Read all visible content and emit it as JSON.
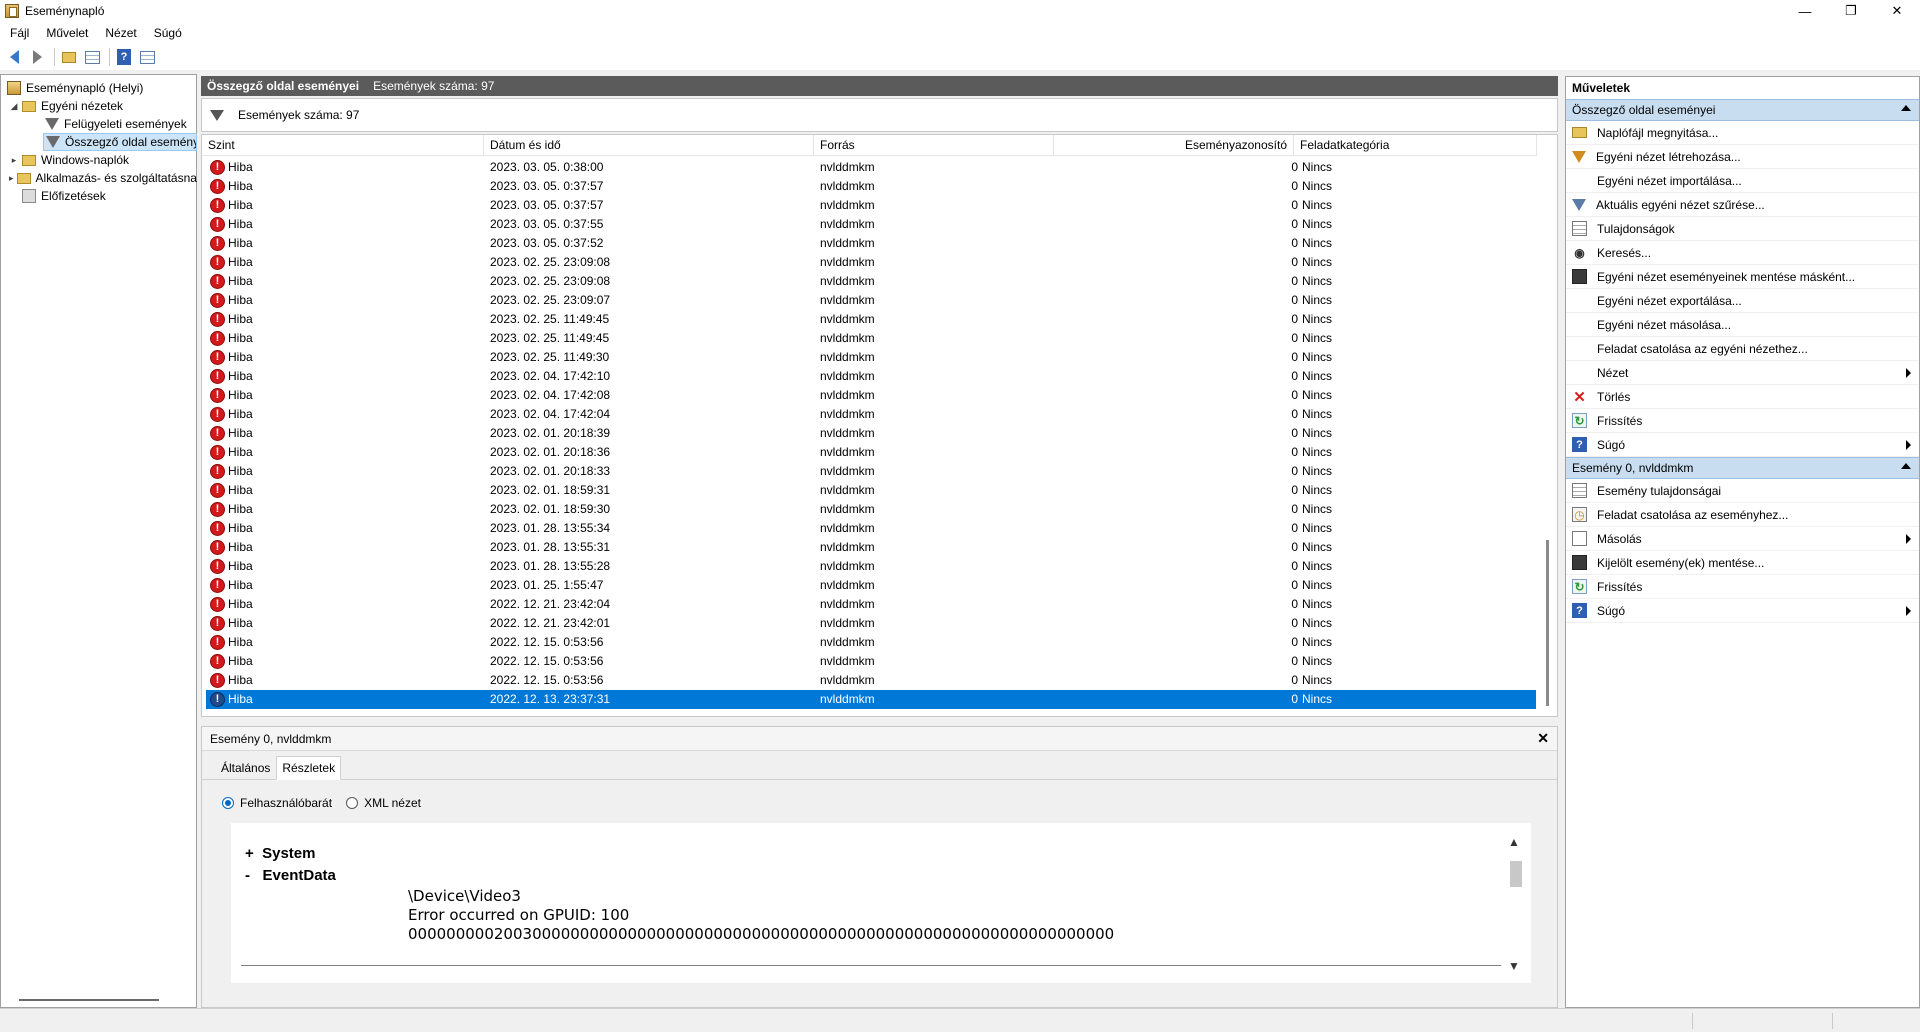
{
  "window": {
    "title": "Eseménynapló"
  },
  "menu": [
    "Fájl",
    "Művelet",
    "Nézet",
    "Súgó"
  ],
  "tree": {
    "root": "Eseménynapló (Helyi)",
    "custom_views": "Egyéni nézetek",
    "admin_events": "Felügyeleti események",
    "summary_events": "Összegző oldal eseményei",
    "windows_logs": "Windows-naplók",
    "app_service_logs": "Alkalmazás- és szolgáltatásnaplók",
    "subscriptions": "Előfizetések"
  },
  "center": {
    "title": "Összegző oldal eseményei",
    "count": "Események száma: 97",
    "filter_text": "Események száma: 97"
  },
  "table": {
    "headers": {
      "level": "Szint",
      "date": "Dátum és idő",
      "source": "Forrás",
      "event_id": "Eseményazonosító",
      "task": "Feladatkategória"
    },
    "rows": [
      {
        "level": "Hiba",
        "date": "2023. 03. 05. 0:38:00",
        "source": "nvlddmkm",
        "id": "0",
        "task": "Nincs"
      },
      {
        "level": "Hiba",
        "date": "2023. 03. 05. 0:37:57",
        "source": "nvlddmkm",
        "id": "0",
        "task": "Nincs"
      },
      {
        "level": "Hiba",
        "date": "2023. 03. 05. 0:37:57",
        "source": "nvlddmkm",
        "id": "0",
        "task": "Nincs"
      },
      {
        "level": "Hiba",
        "date": "2023. 03. 05. 0:37:55",
        "source": "nvlddmkm",
        "id": "0",
        "task": "Nincs"
      },
      {
        "level": "Hiba",
        "date": "2023. 03. 05. 0:37:52",
        "source": "nvlddmkm",
        "id": "0",
        "task": "Nincs"
      },
      {
        "level": "Hiba",
        "date": "2023. 02. 25. 23:09:08",
        "source": "nvlddmkm",
        "id": "0",
        "task": "Nincs"
      },
      {
        "level": "Hiba",
        "date": "2023. 02. 25. 23:09:08",
        "source": "nvlddmkm",
        "id": "0",
        "task": "Nincs"
      },
      {
        "level": "Hiba",
        "date": "2023. 02. 25. 23:09:07",
        "source": "nvlddmkm",
        "id": "0",
        "task": "Nincs"
      },
      {
        "level": "Hiba",
        "date": "2023. 02. 25. 11:49:45",
        "source": "nvlddmkm",
        "id": "0",
        "task": "Nincs"
      },
      {
        "level": "Hiba",
        "date": "2023. 02. 25. 11:49:45",
        "source": "nvlddmkm",
        "id": "0",
        "task": "Nincs"
      },
      {
        "level": "Hiba",
        "date": "2023. 02. 25. 11:49:30",
        "source": "nvlddmkm",
        "id": "0",
        "task": "Nincs"
      },
      {
        "level": "Hiba",
        "date": "2023. 02. 04. 17:42:10",
        "source": "nvlddmkm",
        "id": "0",
        "task": "Nincs"
      },
      {
        "level": "Hiba",
        "date": "2023. 02. 04. 17:42:08",
        "source": "nvlddmkm",
        "id": "0",
        "task": "Nincs"
      },
      {
        "level": "Hiba",
        "date": "2023. 02. 04. 17:42:04",
        "source": "nvlddmkm",
        "id": "0",
        "task": "Nincs"
      },
      {
        "level": "Hiba",
        "date": "2023. 02. 01. 20:18:39",
        "source": "nvlddmkm",
        "id": "0",
        "task": "Nincs"
      },
      {
        "level": "Hiba",
        "date": "2023. 02. 01. 20:18:36",
        "source": "nvlddmkm",
        "id": "0",
        "task": "Nincs"
      },
      {
        "level": "Hiba",
        "date": "2023. 02. 01. 20:18:33",
        "source": "nvlddmkm",
        "id": "0",
        "task": "Nincs"
      },
      {
        "level": "Hiba",
        "date": "2023. 02. 01. 18:59:31",
        "source": "nvlddmkm",
        "id": "0",
        "task": "Nincs"
      },
      {
        "level": "Hiba",
        "date": "2023. 02. 01. 18:59:30",
        "source": "nvlddmkm",
        "id": "0",
        "task": "Nincs"
      },
      {
        "level": "Hiba",
        "date": "2023. 01. 28. 13:55:34",
        "source": "nvlddmkm",
        "id": "0",
        "task": "Nincs"
      },
      {
        "level": "Hiba",
        "date": "2023. 01. 28. 13:55:31",
        "source": "nvlddmkm",
        "id": "0",
        "task": "Nincs"
      },
      {
        "level": "Hiba",
        "date": "2023. 01. 28. 13:55:28",
        "source": "nvlddmkm",
        "id": "0",
        "task": "Nincs"
      },
      {
        "level": "Hiba",
        "date": "2023. 01. 25. 1:55:47",
        "source": "nvlddmkm",
        "id": "0",
        "task": "Nincs"
      },
      {
        "level": "Hiba",
        "date": "2022. 12. 21. 23:42:04",
        "source": "nvlddmkm",
        "id": "0",
        "task": "Nincs"
      },
      {
        "level": "Hiba",
        "date": "2022. 12. 21. 23:42:01",
        "source": "nvlddmkm",
        "id": "0",
        "task": "Nincs"
      },
      {
        "level": "Hiba",
        "date": "2022. 12. 15. 0:53:56",
        "source": "nvlddmkm",
        "id": "0",
        "task": "Nincs"
      },
      {
        "level": "Hiba",
        "date": "2022. 12. 15. 0:53:56",
        "source": "nvlddmkm",
        "id": "0",
        "task": "Nincs"
      },
      {
        "level": "Hiba",
        "date": "2022. 12. 15. 0:53:56",
        "source": "nvlddmkm",
        "id": "0",
        "task": "Nincs"
      },
      {
        "level": "Hiba",
        "date": "2022. 12. 13. 23:37:31",
        "source": "nvlddmkm",
        "id": "0",
        "task": "Nincs",
        "selected": true
      }
    ]
  },
  "detail": {
    "title": "Esemény 0, nvlddmkm",
    "tabs": [
      "Általános",
      "Részletek"
    ],
    "radio_friendly": "Felhasználóbarát",
    "radio_xml": "XML nézet",
    "system_label": "System",
    "system_sign": "+",
    "eventdata_label": "EventData",
    "eventdata_sign": "-",
    "data_lines": [
      "\\Device\\Video3",
      "Error occurred on GPUID: 100",
      "00000000020030000000000000000000000000000000000000000000000000000000000000"
    ]
  },
  "actions": {
    "title": "Műveletek",
    "section1": "Összegző oldal eseményei",
    "items1": [
      {
        "icon": "open-log-icon",
        "label": "Naplófájl megnyitása...",
        "submenu": false
      },
      {
        "icon": "create-view-icon",
        "label": "Egyéni nézet létrehozása...",
        "submenu": false
      },
      {
        "icon": "",
        "label": "Egyéni nézet importálása...",
        "submenu": false
      },
      {
        "icon": "filter-icon",
        "label": "Aktuális egyéni nézet szűrése...",
        "submenu": false
      },
      {
        "icon": "properties-icon",
        "label": "Tulajdonságok",
        "submenu": false
      },
      {
        "icon": "find-icon",
        "label": "Keresés...",
        "submenu": false
      },
      {
        "icon": "save-icon",
        "label": "Egyéni nézet eseményeinek mentése másként...",
        "submenu": false
      },
      {
        "icon": "",
        "label": "Egyéni nézet exportálása...",
        "submenu": false
      },
      {
        "icon": "",
        "label": "Egyéni nézet másolása...",
        "submenu": false
      },
      {
        "icon": "",
        "label": "Feladat csatolása az egyéni nézethez...",
        "submenu": false
      },
      {
        "icon": "",
        "label": "Nézet",
        "submenu": true
      },
      {
        "icon": "delete-icon",
        "label": "Törlés",
        "submenu": false
      },
      {
        "icon": "refresh-icon",
        "label": "Frissítés",
        "submenu": false
      },
      {
        "icon": "help-icon",
        "label": "Súgó",
        "submenu": true
      }
    ],
    "section2": "Esemény 0, nvlddmkm",
    "items2": [
      {
        "icon": "event-properties-icon",
        "label": "Esemény tulajdonságai",
        "submenu": false
      },
      {
        "icon": "attach-task-icon",
        "label": "Feladat csatolása az eseményhez...",
        "submenu": false
      },
      {
        "icon": "copy-icon",
        "label": "Másolás",
        "submenu": true
      },
      {
        "icon": "save-icon",
        "label": "Kijelölt esemény(ek) mentése...",
        "submenu": false
      },
      {
        "icon": "refresh-icon",
        "label": "Frissítés",
        "submenu": false
      },
      {
        "icon": "help-icon",
        "label": "Súgó",
        "submenu": true
      }
    ]
  },
  "glyphs": {
    "minimize": "—",
    "maximize": "❐",
    "close": "✕",
    "detail_close": "✕",
    "error": "!",
    "help": "?",
    "expand": "▸",
    "collapse": "◢",
    "scroll_up": "▲",
    "scroll_down": "▼"
  },
  "colors": {
    "selection": "#0078d7",
    "error_icon": "#d31a1a",
    "section_header": "#c9ddf1"
  }
}
